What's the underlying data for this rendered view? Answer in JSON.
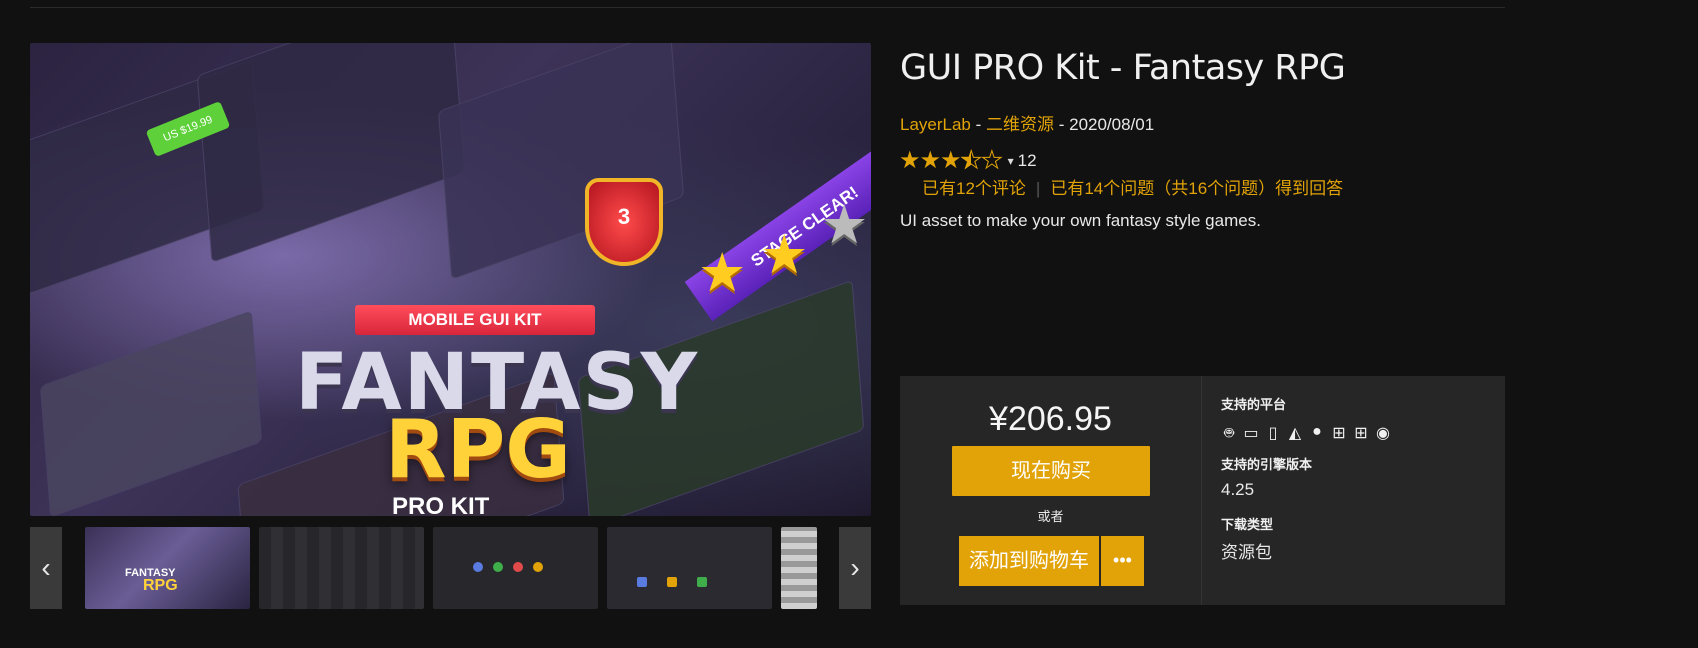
{
  "product": {
    "title": "GUI PRO Kit - Fantasy RPG",
    "publisher": "LayerLab",
    "meta_sep1": " - ",
    "category": "二维资源",
    "meta_sep2": " - ",
    "date": "2020/08/01",
    "rating_value": 3.5,
    "rating_max": 5,
    "rating_count": "12",
    "reviews_link": "已有12个评论",
    "questions_link": "已有14个问题（共16个问题）得到回答",
    "description": "UI asset to make your own fantasy style games."
  },
  "hero": {
    "ribbon": "MOBILE GUI KIT",
    "title_line1": "FANTASY",
    "title_line2": "RPG",
    "title_line3": "PRO KIT",
    "stage_ribbon": "STAGE CLEAR!",
    "shield_number": "3",
    "price_button": "US $19.99"
  },
  "thumbnails": {
    "thumb1_line1": "FANTASY",
    "thumb1_line2": "RPG",
    "prev_icon": "chevron-left-icon",
    "next_icon": "chevron-right-icon"
  },
  "purchase": {
    "price": "¥206.95",
    "buy_now": "现在购买",
    "or": "或者",
    "add_to_cart": "添加到购物车",
    "more": "•••",
    "platforms_label": "支持的平台",
    "platform_icons": [
      "android-icon",
      "desktop-icon",
      "mobile-icon",
      "linux-icon",
      "apple-icon",
      "windows-icon",
      "windows-store-icon",
      "vr-eye-icon"
    ],
    "engine_label": "支持的引擎版本",
    "engine_value": "4.25",
    "download_label": "下载类型",
    "download_value": "资源包"
  },
  "colors": {
    "accent": "#e2a308",
    "background": "#111111",
    "panel": "#262626"
  }
}
